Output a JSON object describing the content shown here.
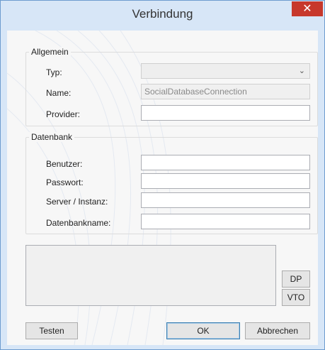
{
  "window": {
    "title": "Verbindung",
    "close_glyph": "✕"
  },
  "general_group": {
    "label": "Allgemein",
    "type_label": "Typ:",
    "type_value": "",
    "name_label": "Name:",
    "name_value": "SocialDatabaseConnection",
    "provider_label": "Provider:",
    "provider_value": ""
  },
  "database_group": {
    "label": "Datenbank",
    "user_label": "Benutzer:",
    "user_value": "",
    "password_label": "Passwort:",
    "password_value": "",
    "server_label": "Server / Instanz:",
    "server_value": "",
    "dbname_label": "Datenbankname:",
    "dbname_value": ""
  },
  "side_buttons": {
    "dp": "DP",
    "vto": "VTO"
  },
  "footer": {
    "test": "Testen",
    "ok": "OK",
    "cancel": "Abbrechen"
  },
  "icons": {
    "dropdown": "chevron-down-icon",
    "close": "close-icon"
  },
  "colors": {
    "title_bg": "#d7e6f7",
    "close_bg": "#c7382c",
    "dialog_bg": "#f7f7f7"
  }
}
